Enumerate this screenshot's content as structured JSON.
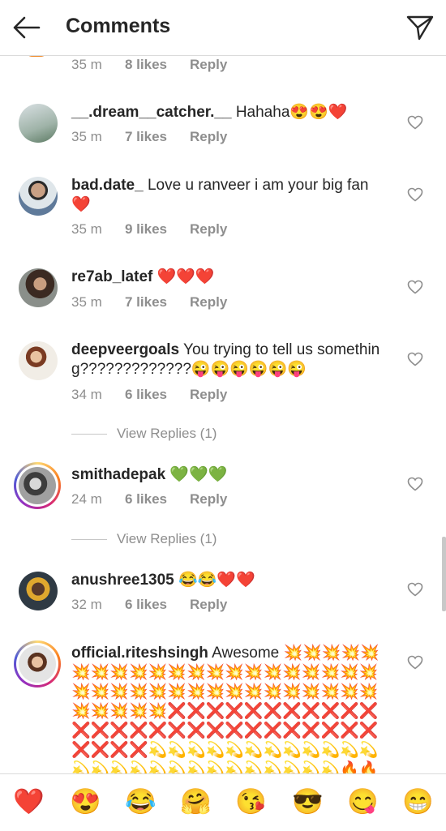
{
  "header": {
    "title": "Comments",
    "back_icon": "arrow-left-icon",
    "send_icon": "paper-plane-icon"
  },
  "comments": [
    {
      "user": "",
      "text": "",
      "time": "35 m",
      "likes": "8 likes",
      "reply": "Reply"
    },
    {
      "user": "__.dream__catcher.__",
      "text": " Hahaha😍😍❤️",
      "time": "35 m",
      "likes": "7 likes",
      "reply": "Reply"
    },
    {
      "user": "bad.date_",
      "text": " Love u ranveer i am your big fan ❤️",
      "time": "35 m",
      "likes": "9 likes",
      "reply": "Reply"
    },
    {
      "user": "re7ab_latef",
      "text": " ❤️❤️❤️",
      "time": "35 m",
      "likes": "7 likes",
      "reply": "Reply"
    },
    {
      "user": "deepveergoals",
      "text": " You trying to tell us something?????????????😜😜😜😜😜😜",
      "time": "34 m",
      "likes": "6 likes",
      "reply": "Reply",
      "view_replies": "View Replies (1)"
    },
    {
      "user": "smithadepak",
      "text": " 💚💚💚",
      "time": "24 m",
      "likes": "6 likes",
      "reply": "Reply",
      "view_replies": "View Replies (1)"
    },
    {
      "user": "anushree1305",
      "text": " 😂😂❤️❤️",
      "time": "32 m",
      "likes": "6 likes",
      "reply": "Reply"
    },
    {
      "user": "official.riteshsingh",
      "text": " Awesome 💥💥💥💥💥💥💥💥💥💥💥💥💥💥💥💥💥💥💥💥💥💥💥💥💥💥💥💥💥💥💥💥💥💥💥💥💥💥💥💥💥💥❌❌❌❌❌❌❌❌❌❌❌❌❌❌❌❌❌❌❌❌❌❌❌❌❌❌❌❌❌❌❌💫💫💫💫💫💫💫💫💫💫💫💫💫💫💫💫💫💫💫💫💫💫💫💫💫💫🔥🔥🔥🔥🔥🔥🔥🔥🔥🔥🔥🔥"
    }
  ],
  "emoji_bar": [
    "❤️",
    "😍",
    "😂",
    "🤗",
    "😘",
    "😎",
    "😋",
    "😁"
  ],
  "colors": {
    "text": "#262626",
    "secondary": "#8e8e8e",
    "divider": "#dbdbdb"
  }
}
